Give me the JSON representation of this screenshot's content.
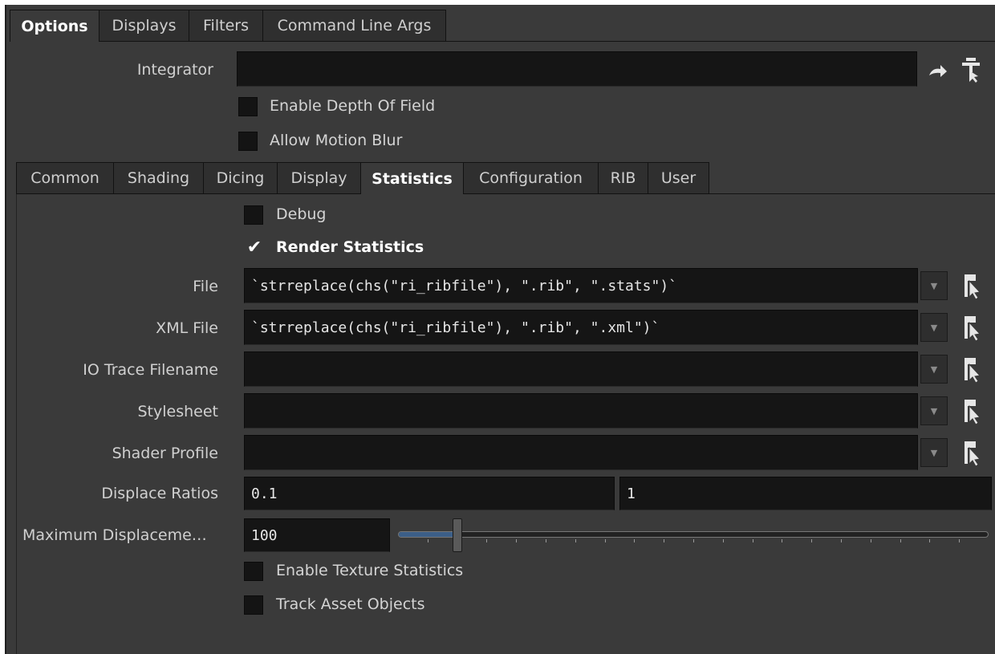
{
  "top_tabs": [
    {
      "label": "Options",
      "active": true
    },
    {
      "label": "Displays",
      "active": false
    },
    {
      "label": "Filters",
      "active": false
    },
    {
      "label": "Command Line Args",
      "active": false
    }
  ],
  "integrator": {
    "label": "Integrator",
    "value": ""
  },
  "enable_dof": {
    "label": "Enable Depth Of Field",
    "checked": false
  },
  "allow_motion_blur": {
    "label": "Allow Motion Blur",
    "checked": false
  },
  "sub_tabs": [
    {
      "label": "Common",
      "active": false
    },
    {
      "label": "Shading",
      "active": false
    },
    {
      "label": "Dicing",
      "active": false
    },
    {
      "label": "Display",
      "active": false
    },
    {
      "label": "Statistics",
      "active": true
    },
    {
      "label": "Configuration",
      "active": false
    },
    {
      "label": "RIB",
      "active": false
    },
    {
      "label": "User",
      "active": false
    }
  ],
  "debug": {
    "label": "Debug",
    "checked": false
  },
  "render_statistics": {
    "label": "Render Statistics",
    "checked": true,
    "check_glyph": "✔"
  },
  "file": {
    "label": "File",
    "value": "`strreplace(chs(\"ri_ribfile\"), \".rib\", \".stats\")`"
  },
  "xml_file": {
    "label": "XML File",
    "value": "`strreplace(chs(\"ri_ribfile\"), \".rib\", \".xml\")`"
  },
  "io_trace": {
    "label": "IO Trace Filename",
    "value": ""
  },
  "stylesheet": {
    "label": "Stylesheet",
    "value": ""
  },
  "shader_profile": {
    "label": "Shader Profile",
    "value": ""
  },
  "displace_ratios": {
    "label": "Displace Ratios",
    "value1": "0.1",
    "value2": "1"
  },
  "max_displacement": {
    "label": "Maximum Displaceme…",
    "value": "100",
    "slider_fraction": 0.1
  },
  "enable_texture_stats": {
    "label": "Enable Texture Statistics",
    "checked": false
  },
  "track_asset_objects": {
    "label": "Track Asset Objects",
    "checked": false
  },
  "icons": {
    "dropdown": "▼",
    "file_chooser": "file-chooser-icon",
    "jump": "jump-arrow-icon",
    "pin": "pin-icon"
  },
  "colors": {
    "panel": "#3a3a3a",
    "field": "#151515",
    "accent": "#3c5f88"
  }
}
